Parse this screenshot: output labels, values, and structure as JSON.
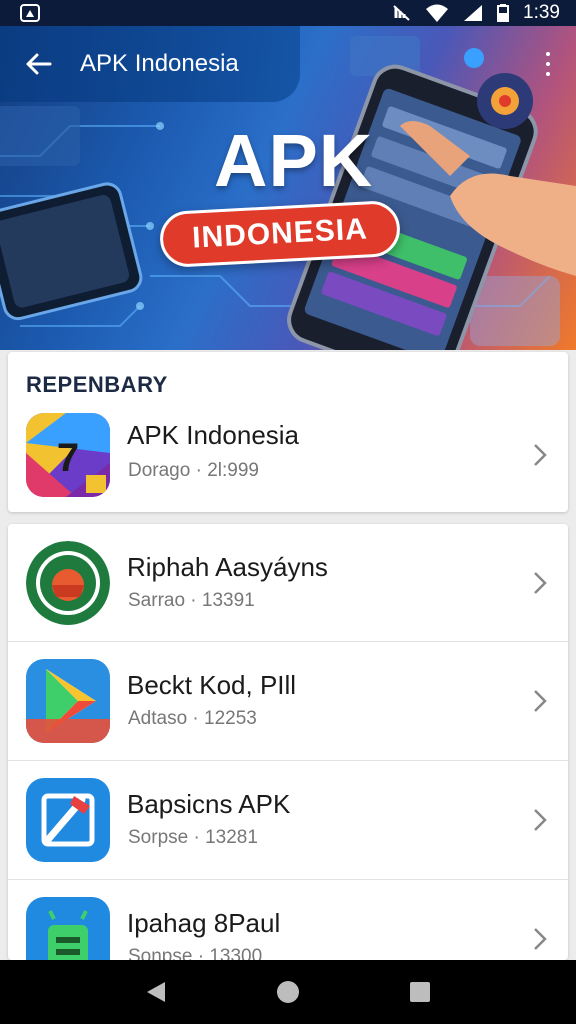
{
  "status_bar": {
    "time": "1:39"
  },
  "app_bar": {
    "title": "APK Indonesia"
  },
  "hero": {
    "title": "APK",
    "badge": "INDONESIA"
  },
  "featured": {
    "section_title": "REPENBARY",
    "item": {
      "name": "APK Indonesia",
      "sub": "Dorago · 2l:999",
      "icon_label": "7"
    }
  },
  "apps": [
    {
      "name": "Riphah Aasyáyns",
      "sub": "Sarrao · 13391"
    },
    {
      "name": "Beckt Kod, PIll",
      "sub": "Adtaso · 12253"
    },
    {
      "name": "Bapsicns APK",
      "sub": "Sorpse · 13281"
    },
    {
      "name": "Ipahag 8Paul",
      "sub": "Sonpse · 13300"
    }
  ],
  "colors": {
    "status_bar": "#0d1b3a",
    "badge_red": "#e03a2a",
    "hero_blue": "#1c5bb1",
    "hero_orange": "#f07a2a"
  },
  "icons": [
    "back-arrow-icon",
    "more-vert-icon",
    "chevron-right-icon",
    "wifi-icon",
    "signal-icon",
    "battery-icon"
  ]
}
